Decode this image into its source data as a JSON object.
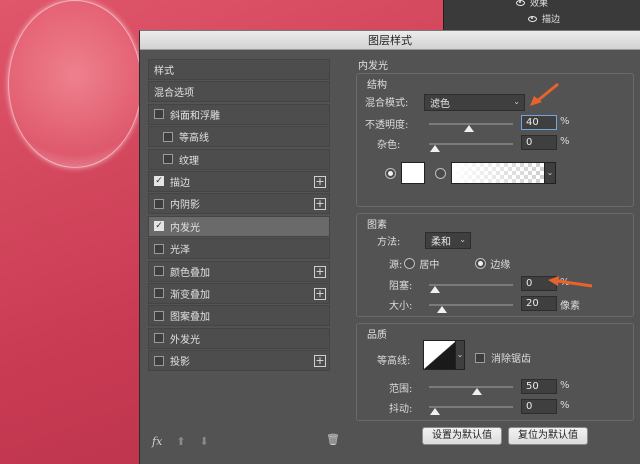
{
  "layers_panel": {
    "effects_label": "效果",
    "stroke_label": "描边"
  },
  "dialog": {
    "title": "图层样式"
  },
  "styles_list": [
    {
      "label": "样式",
      "checkbox": false,
      "checked": false,
      "plus": false,
      "selected": false
    },
    {
      "label": "混合选项",
      "checkbox": false,
      "checked": false,
      "plus": false,
      "selected": false
    },
    {
      "label": "斜面和浮雕",
      "checkbox": true,
      "checked": false,
      "plus": false,
      "selected": false
    },
    {
      "label": "等高线",
      "checkbox": true,
      "checked": false,
      "plus": false,
      "selected": false,
      "indent": true
    },
    {
      "label": "纹理",
      "checkbox": true,
      "checked": false,
      "plus": false,
      "selected": false,
      "indent": true
    },
    {
      "label": "描边",
      "checkbox": true,
      "checked": true,
      "plus": true,
      "selected": false
    },
    {
      "label": "内阴影",
      "checkbox": true,
      "checked": false,
      "plus": true,
      "selected": false
    },
    {
      "label": "内发光",
      "checkbox": true,
      "checked": true,
      "plus": false,
      "selected": true
    },
    {
      "label": "光泽",
      "checkbox": true,
      "checked": false,
      "plus": false,
      "selected": false
    },
    {
      "label": "颜色叠加",
      "checkbox": true,
      "checked": false,
      "plus": true,
      "selected": false
    },
    {
      "label": "渐变叠加",
      "checkbox": true,
      "checked": false,
      "plus": true,
      "selected": false
    },
    {
      "label": "图案叠加",
      "checkbox": true,
      "checked": false,
      "plus": false,
      "selected": false
    },
    {
      "label": "外发光",
      "checkbox": true,
      "checked": false,
      "plus": false,
      "selected": false
    },
    {
      "label": "投影",
      "checkbox": true,
      "checked": false,
      "plus": true,
      "selected": false
    }
  ],
  "footer": {
    "fx": "fx"
  },
  "inner_glow": {
    "title": "内发光",
    "structure": {
      "label": "结构",
      "blend_mode_label": "混合模式:",
      "blend_mode_value": "滤色",
      "opacity_label": "不透明度:",
      "opacity_value": "40",
      "opacity_unit": "%",
      "opacity_level": 0.4,
      "noise_label": "杂色:",
      "noise_value": "0",
      "noise_unit": "%",
      "noise_level": 0
    },
    "elements": {
      "label": "图素",
      "method_label": "方法:",
      "method_value": "柔和",
      "source_label": "源:",
      "source_center": "居中",
      "source_edge": "边缘",
      "choke_label": "阻塞:",
      "choke_value": "0",
      "choke_unit": "%",
      "choke_level": 0,
      "size_label": "大小:",
      "size_value": "20",
      "size_unit": "像素",
      "size_level": 0.08
    },
    "quality": {
      "label": "品质",
      "contour_label": "等高线:",
      "antialias_label": "消除锯齿",
      "range_label": "范围:",
      "range_value": "50",
      "range_unit": "%",
      "range_level": 0.5,
      "jitter_label": "抖动:",
      "jitter_value": "0",
      "jitter_unit": "%",
      "jitter_level": 0
    },
    "buttons": {
      "make_default": "设置为默认值",
      "reset_default": "复位为默认值"
    }
  },
  "colors": {
    "annotation_arrow": "#e8622c"
  }
}
